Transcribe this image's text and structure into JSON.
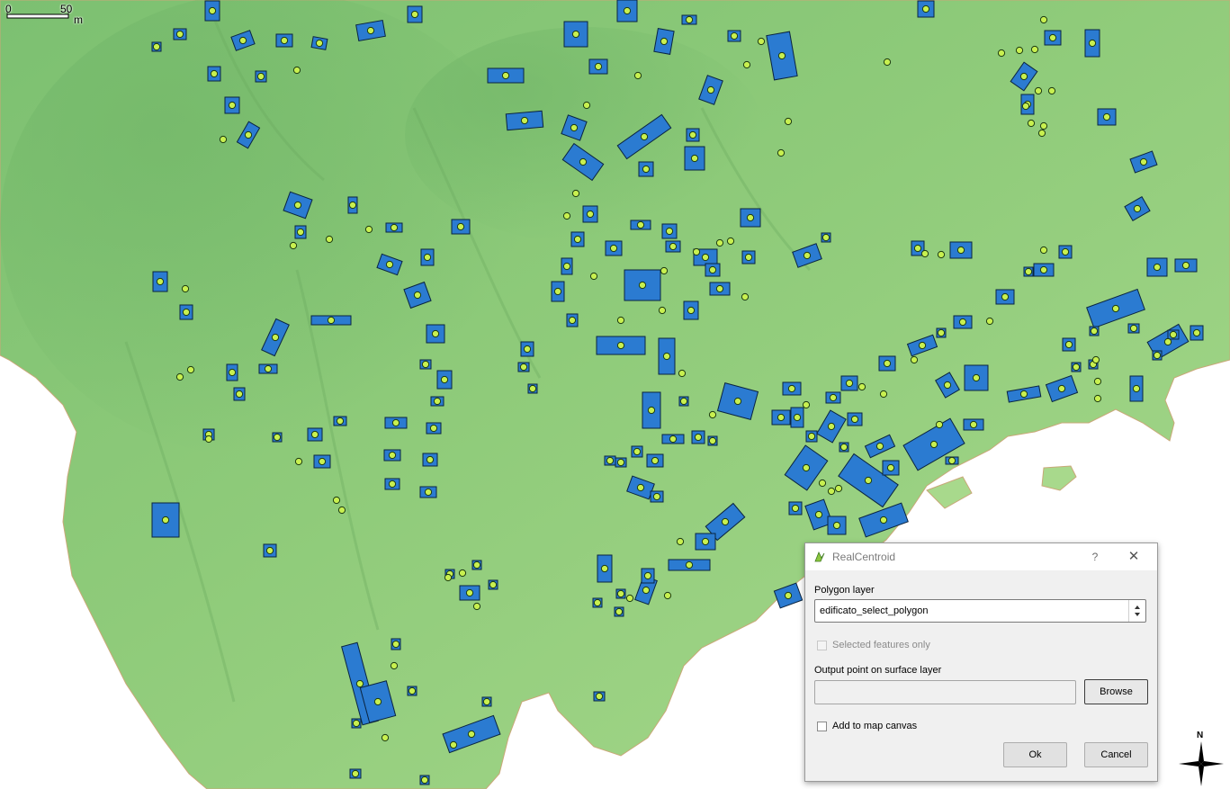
{
  "map": {
    "scale_bar": {
      "start": "0",
      "end": "50",
      "unit": "m"
    },
    "north_arrow": {
      "label": "N"
    },
    "colors": {
      "terrain": "#8cc874",
      "buildings": "#2b7bd1",
      "centroids": "#c8f050",
      "background": "#ffffff"
    }
  },
  "dialog": {
    "title": "RealCentroid",
    "help": "?",
    "close": "✕",
    "polygon_layer_label": "Polygon layer",
    "polygon_layer_value": "edificato_select_polygon",
    "selected_only_label": "Selected features only",
    "output_label": "Output point on surface layer",
    "output_value": "",
    "browse_label": "Browse",
    "add_to_map_label": "Add to map canvas",
    "ok_label": "Ok",
    "cancel_label": "Cancel"
  }
}
